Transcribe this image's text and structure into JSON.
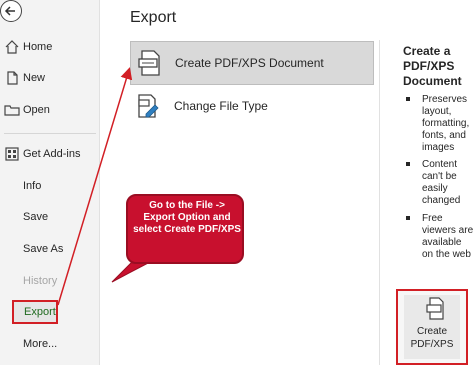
{
  "nav": {
    "items": [
      {
        "label": "Home"
      },
      {
        "label": "New"
      },
      {
        "label": "Open"
      },
      {
        "label": "Get Add-ins"
      },
      {
        "label": "Info"
      },
      {
        "label": "Save"
      },
      {
        "label": "Save As"
      },
      {
        "label": "History"
      },
      {
        "label": "Export"
      },
      {
        "label": "More..."
      }
    ]
  },
  "main": {
    "title": "Export",
    "options": [
      {
        "label": "Create PDF/XPS Document"
      },
      {
        "label": "Change File Type"
      }
    ]
  },
  "right_panel": {
    "title": "Create a PDF/XPS Document",
    "bullets": [
      "Preserves layout, formatting, fonts, and images",
      "Content can't be easily changed",
      "Free viewers are available on the web"
    ],
    "button_label": "Create PDF/XPS"
  },
  "annotation": {
    "text": "Go to the File -> Export Option and select Create PDF/XPS"
  },
  "colors": {
    "annotation_red": "#c8102e",
    "highlight_red": "#d21f25",
    "selected_bg": "#d9d9d9"
  }
}
